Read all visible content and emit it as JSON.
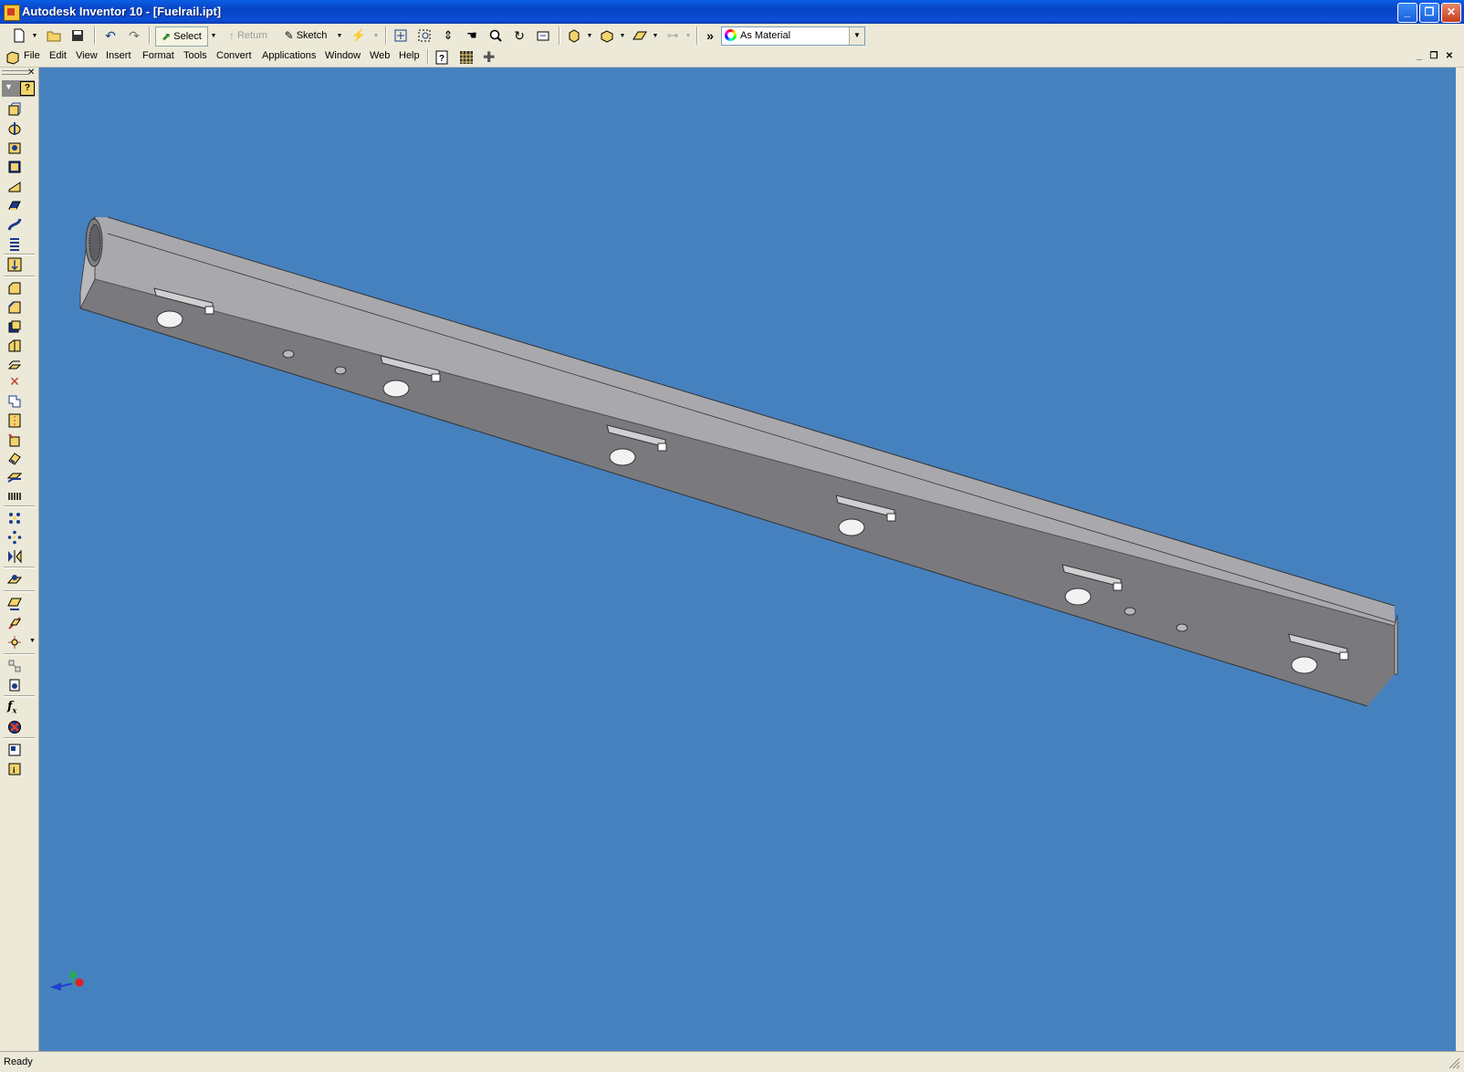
{
  "window": {
    "title": "Autodesk Inventor 10 - [Fuelrail.ipt]",
    "controls": [
      "minimize-button",
      "restore-button",
      "close-button"
    ]
  },
  "toolbar": {
    "select_label": "Select",
    "return_label": "Return",
    "sketch_label": "Sketch",
    "appearance": "As Material"
  },
  "menubar": {
    "items": [
      "File",
      "Edit",
      "View",
      "Insert",
      "Format",
      "Tools",
      "Convert",
      "Applications",
      "Window",
      "Web",
      "Help"
    ]
  },
  "status": {
    "text": "Ready"
  },
  "colors": {
    "viewport_bg": "#4681BF",
    "part_top": "#A9A9AD",
    "part_side": "#7A7A7E",
    "part_end": "#B7B7BA"
  }
}
